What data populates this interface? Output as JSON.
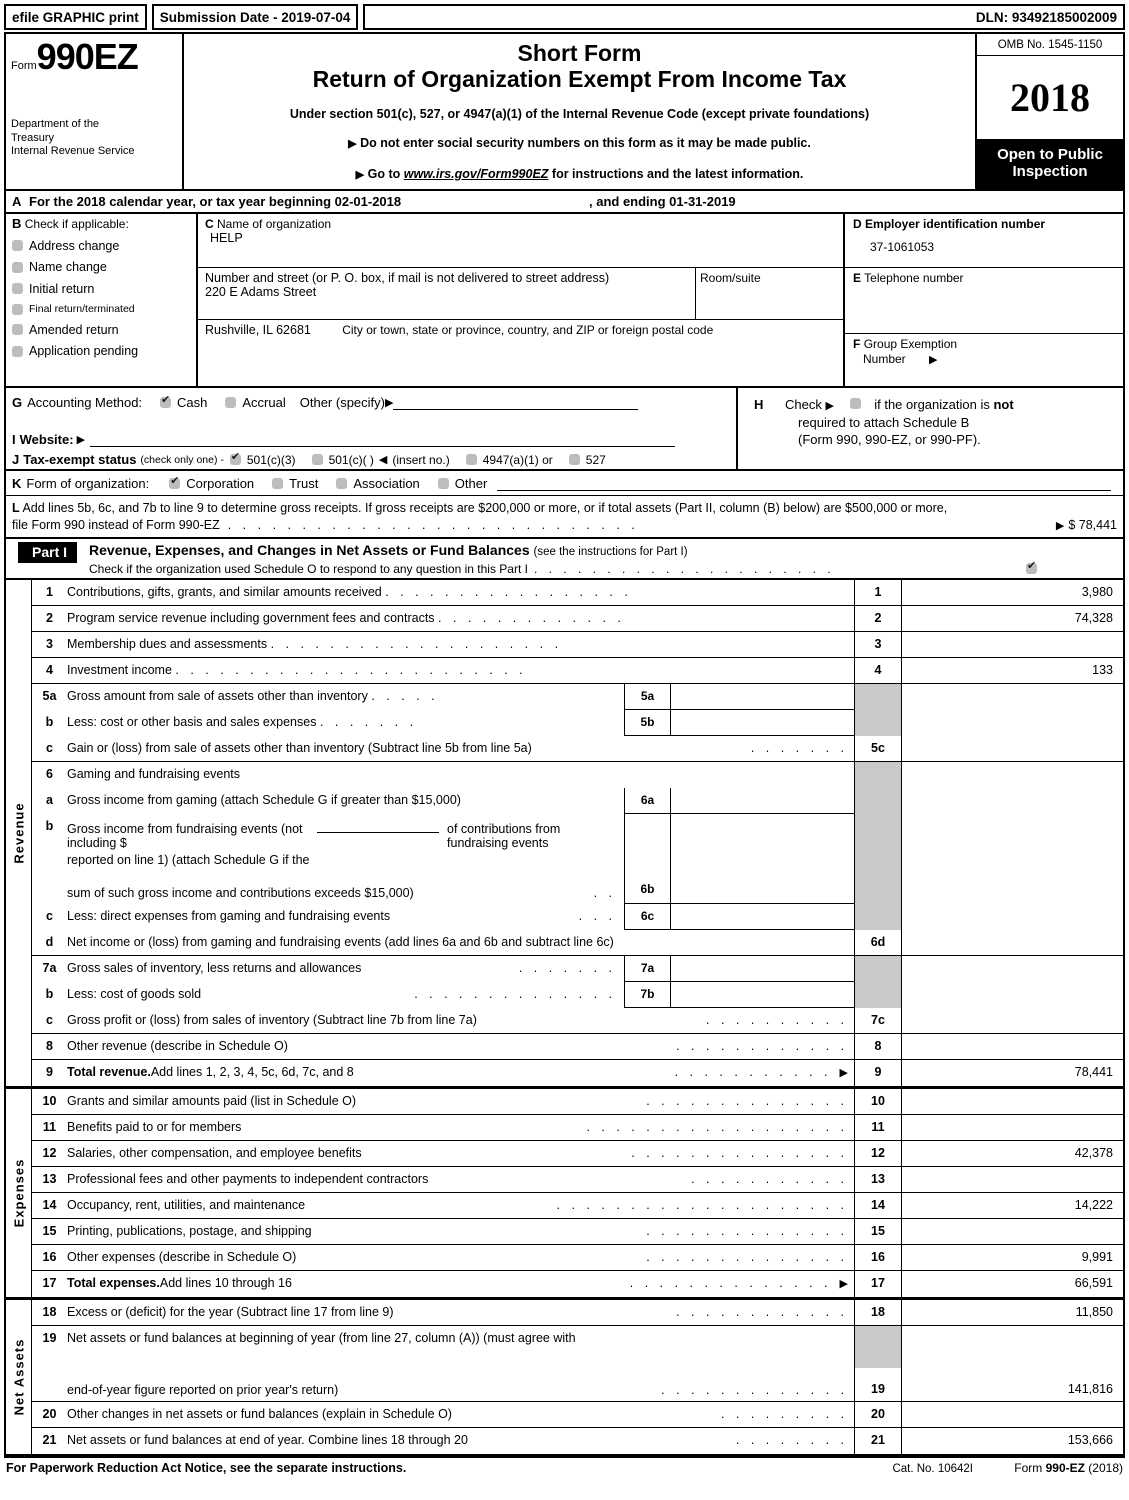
{
  "efile": {
    "graphic_label": "efile GRAPHIC print",
    "submission_label": "Submission Date - 2019-07-04",
    "dln": "DLN: 93492185002009"
  },
  "header": {
    "form_word": "Form",
    "form_number": "990EZ",
    "dept_line1": "Department of the",
    "dept_line2": "Treasury",
    "dept_line3": "Internal Revenue Service",
    "short_form": "Short Form",
    "main_title": "Return of Organization Exempt From Income Tax",
    "under_section": "Under section 501(c), 527, or 4947(a)(1) of the Internal Revenue Code (except private foundations)",
    "bullet1": "Do not enter social security numbers on this form as it may be made public.",
    "bullet2_pre": "Go to ",
    "bullet2_url": "www.irs.gov/Form990EZ",
    "bullet2_post": " for instructions and the latest information.",
    "omb": "OMB No. 1545-1150",
    "tax_year": "2018",
    "open_to_public_1": "Open to Public",
    "open_to_public_2": "Inspection"
  },
  "lineA": {
    "letter": "A",
    "text": "For the 2018 calendar year, or tax year beginning 02-01-2018",
    "ending": ", and ending 01-31-2019"
  },
  "sectionB": {
    "letter": "B",
    "title": "Check if applicable:",
    "options": [
      {
        "label": "Address change",
        "checked": false,
        "small": false
      },
      {
        "label": "Name change",
        "checked": false,
        "small": false
      },
      {
        "label": "Initial return",
        "checked": false,
        "small": false
      },
      {
        "label": "Final return/terminated",
        "checked": false,
        "small": true
      },
      {
        "label": "Amended return",
        "checked": false,
        "small": false
      },
      {
        "label": "Application pending",
        "checked": false,
        "small": false
      }
    ]
  },
  "sectionC": {
    "letter": "C",
    "name_caption": "Name of organization",
    "org_name": "HELP",
    "street_caption": "Number and street (or P. O. box, if mail is not delivered to street address)",
    "street_value": "220 E Adams Street",
    "room_caption": "Room/suite",
    "room_value": "",
    "city_value": "Rushville, IL   62681",
    "city_caption": "City or town, state or province, country, and ZIP or foreign postal code"
  },
  "sectionD": {
    "letter": "D",
    "caption": "Employer identification number",
    "value": "37-1061053"
  },
  "sectionE": {
    "letter": "E",
    "caption": "Telephone number",
    "value": ""
  },
  "sectionF": {
    "letter": "F",
    "caption_l1": "Group Exemption",
    "caption_l2": "Number"
  },
  "sectionG": {
    "letter": "G",
    "label": "Accounting Method:",
    "cash": "Cash",
    "cash_checked": true,
    "accrual": "Accrual",
    "accrual_checked": false,
    "other": "Other (specify)"
  },
  "sectionH": {
    "letter": "H",
    "line1_pre": "Check",
    "line1_post": "if the organization is ",
    "line1_bold": "not",
    "line2": "required to attach Schedule B",
    "line3": "(Form 990, 990-EZ, or 990-PF)."
  },
  "sectionI": {
    "letter": "I",
    "label": "Website:",
    "value": ""
  },
  "sectionJ": {
    "letter": "J",
    "label": "Tax-exempt status",
    "note": "(check only one) -",
    "opt1": "501(c)(3)",
    "opt1_checked": true,
    "opt2": "501(c)(  )",
    "opt2_checked": false,
    "insert": "(insert no.)",
    "opt3": "4947(a)(1) or",
    "opt3_checked": false,
    "opt4": "527",
    "opt4_checked": false
  },
  "sectionK": {
    "letter": "K",
    "label": "Form of organization:",
    "options": [
      {
        "label": "Corporation",
        "checked": true
      },
      {
        "label": "Trust",
        "checked": false
      },
      {
        "label": "Association",
        "checked": false
      },
      {
        "label": "Other",
        "checked": false
      }
    ]
  },
  "sectionL": {
    "letter": "L",
    "line1": "Add lines 5b, 6c, and 7b to line 9 to determine gross receipts. If gross receipts are $200,000 or more, or if total assets (Part II, column (B) below) are $500,000 or more,",
    "line2": "file Form 990 instead of Form 990-EZ",
    "amount": "$ 78,441"
  },
  "partI": {
    "tag": "Part I",
    "heading": "Revenue, Expenses, and Changes in Net Assets or Fund Balances",
    "heading_note": "(see the instructions for Part I)",
    "sub": "Check if the organization used Schedule O to respond to any question in this Part I",
    "sub_checked": true
  },
  "revenue": {
    "vlabel": "Revenue",
    "rows": [
      {
        "num": "1",
        "text": "Contributions, gifts, grants, and similar amounts received",
        "dots": ". . . . . . . . . . . . . . . . .",
        "code": "1",
        "amount": "3,980"
      },
      {
        "num": "2",
        "text": "Program service revenue including government fees and contracts",
        "dots": ". . . . . . . . . . . . .",
        "code": "2",
        "amount": "74,328"
      },
      {
        "num": "3",
        "text": "Membership dues and assessments",
        "dots": ". . . . . . . . . . . . . . . . . . . .",
        "code": "3",
        "amount": ""
      },
      {
        "num": "4",
        "text": "Investment income",
        "dots": ". . . . . . . . . . . . . . . . . . . . . . . .",
        "code": "4",
        "amount": "133"
      },
      {
        "num": "5a",
        "text": "Gross amount from sale of assets other than inventory",
        "dots": ". . . . .",
        "sub_code": "5a",
        "sub_value": "",
        "shaded": true
      },
      {
        "num": "b",
        "text": "Less: cost or other basis and sales expenses",
        "dots": ". . . . . . .",
        "sub_code": "5b",
        "sub_value": "",
        "shaded": true
      },
      {
        "num": "c",
        "text": "Gain or (loss) from sale of assets other than inventory (Subtract line 5b from line 5a)",
        "dots": ". . . . . . .",
        "code": "5c",
        "amount": ""
      },
      {
        "num": "6",
        "text": "Gaming and fundraising events",
        "dots": "",
        "shaded": true,
        "amount": ""
      },
      {
        "num": "a",
        "text": "Gross income from gaming (attach Schedule G if greater than $15,000)",
        "dots": "",
        "sub_code": "6a",
        "sub_value": "",
        "shaded": true
      },
      {
        "num": "b",
        "text": "Gross income from fundraising events (not including $",
        "text2": "of contributions from fundraising events",
        "text3": "reported on line 1) (attach Schedule G if the",
        "shaded": true,
        "blank_field": true
      },
      {
        "num": "",
        "text": "sum of such gross income and contributions exceeds $15,000)",
        "dots": ". .",
        "sub_code": "6b",
        "sub_value": "",
        "shaded": true
      },
      {
        "num": "c",
        "text": "Less: direct expenses from gaming and fundraising events",
        "dots": ". . .",
        "sub_code": "6c",
        "sub_value": "",
        "shaded": true
      },
      {
        "num": "d",
        "text": "Net income or (loss) from gaming and fundraising events (add lines 6a and 6b and subtract line 6c)",
        "dots": "",
        "code": "6d",
        "amount": ""
      },
      {
        "num": "7a",
        "text": "Gross sales of inventory, less returns and allowances",
        "dots": ". . . . . . .",
        "sub_code": "7a",
        "sub_value": "",
        "shaded": true
      },
      {
        "num": "b",
        "text": "Less: cost of goods sold",
        "dots": ". . . . . . . . . . . . . .",
        "sub_code": "7b",
        "sub_value": "",
        "shaded": true
      },
      {
        "num": "c",
        "text": "Gross profit or (loss) from sales of inventory (Subtract line 7b from line 7a)",
        "dots": ". . . . . . . . . .",
        "code": "7c",
        "amount": ""
      },
      {
        "num": "8",
        "text": "Other revenue (describe in Schedule O)",
        "dots": ". . . . . . . . . . . .",
        "code": "8",
        "amount": ""
      },
      {
        "num": "9",
        "text_bold": "Total revenue.",
        "text": " Add lines 1, 2, 3, 4, 5c, 6d, 7c, and 8",
        "dots": ". . . . . . . . . . .",
        "arrow": true,
        "code": "9",
        "amount": "78,441"
      }
    ]
  },
  "expenses": {
    "vlabel": "Expenses",
    "rows": [
      {
        "num": "10",
        "text": "Grants and similar amounts paid (list in Schedule O)",
        "dots": ". . . . . . . . . . . . . .",
        "code": "10",
        "amount": ""
      },
      {
        "num": "11",
        "text": "Benefits paid to or for members",
        "dots": ". . . . . . . . . . . . . . . . . .",
        "code": "11",
        "amount": ""
      },
      {
        "num": "12",
        "text": "Salaries, other compensation, and employee benefits",
        "dots": ". . . . . . . . . . . . . . .",
        "code": "12",
        "amount": "42,378"
      },
      {
        "num": "13",
        "text": "Professional fees and other payments to independent contractors",
        "dots": ". . . . . . . . . . .",
        "code": "13",
        "amount": ""
      },
      {
        "num": "14",
        "text": "Occupancy, rent, utilities, and maintenance",
        "dots": ". . . . . . . . . . . . . . . . . . . .",
        "code": "14",
        "amount": "14,222"
      },
      {
        "num": "15",
        "text": "Printing, publications, postage, and shipping",
        "dots": ". . . . . . . . . . . . . .",
        "code": "15",
        "amount": ""
      },
      {
        "num": "16",
        "text": "Other expenses (describe in Schedule O)",
        "dots": ". . . . . . . . . . . . . .",
        "code": "16",
        "amount": "9,991"
      },
      {
        "num": "17",
        "text_bold": "Total expenses.",
        "text": " Add lines 10 through 16",
        "dots": ". . . . . . . . . . . . . .",
        "arrow": true,
        "code": "17",
        "amount": "66,591"
      }
    ]
  },
  "netassets": {
    "vlabel": "Net Assets",
    "rows": [
      {
        "num": "18",
        "text": "Excess or (deficit) for the year (Subtract line 17 from line 9)",
        "dots": ". . . . . . . . . . . .",
        "code": "18",
        "amount": "11,850"
      },
      {
        "num": "19",
        "text": "Net assets or fund balances at beginning of year (from line 27, column (A)) (must agree with",
        "dots": "",
        "shaded": true,
        "amount": ""
      },
      {
        "num": "",
        "text": "end-of-year figure reported on prior year's return)",
        "dots": ". . . . . . . . . . . . .",
        "code": "19",
        "amount": "141,816"
      },
      {
        "num": "20",
        "text": "Other changes in net assets or fund balances (explain in Schedule O)",
        "dots": ". . . . . . . . .",
        "code": "20",
        "amount": ""
      },
      {
        "num": "21",
        "text": "Net assets or fund balances at end of year. Combine lines 18 through 20",
        "dots": ". . . . . . . .",
        "code": "21",
        "amount": "153,666"
      }
    ]
  },
  "footer": {
    "notice": "For Paperwork Reduction Act Notice, see the separate instructions.",
    "cat": "Cat. No. 10642I",
    "form_pre": "Form ",
    "form_bold": "990-EZ",
    "form_year": " (2018)"
  }
}
